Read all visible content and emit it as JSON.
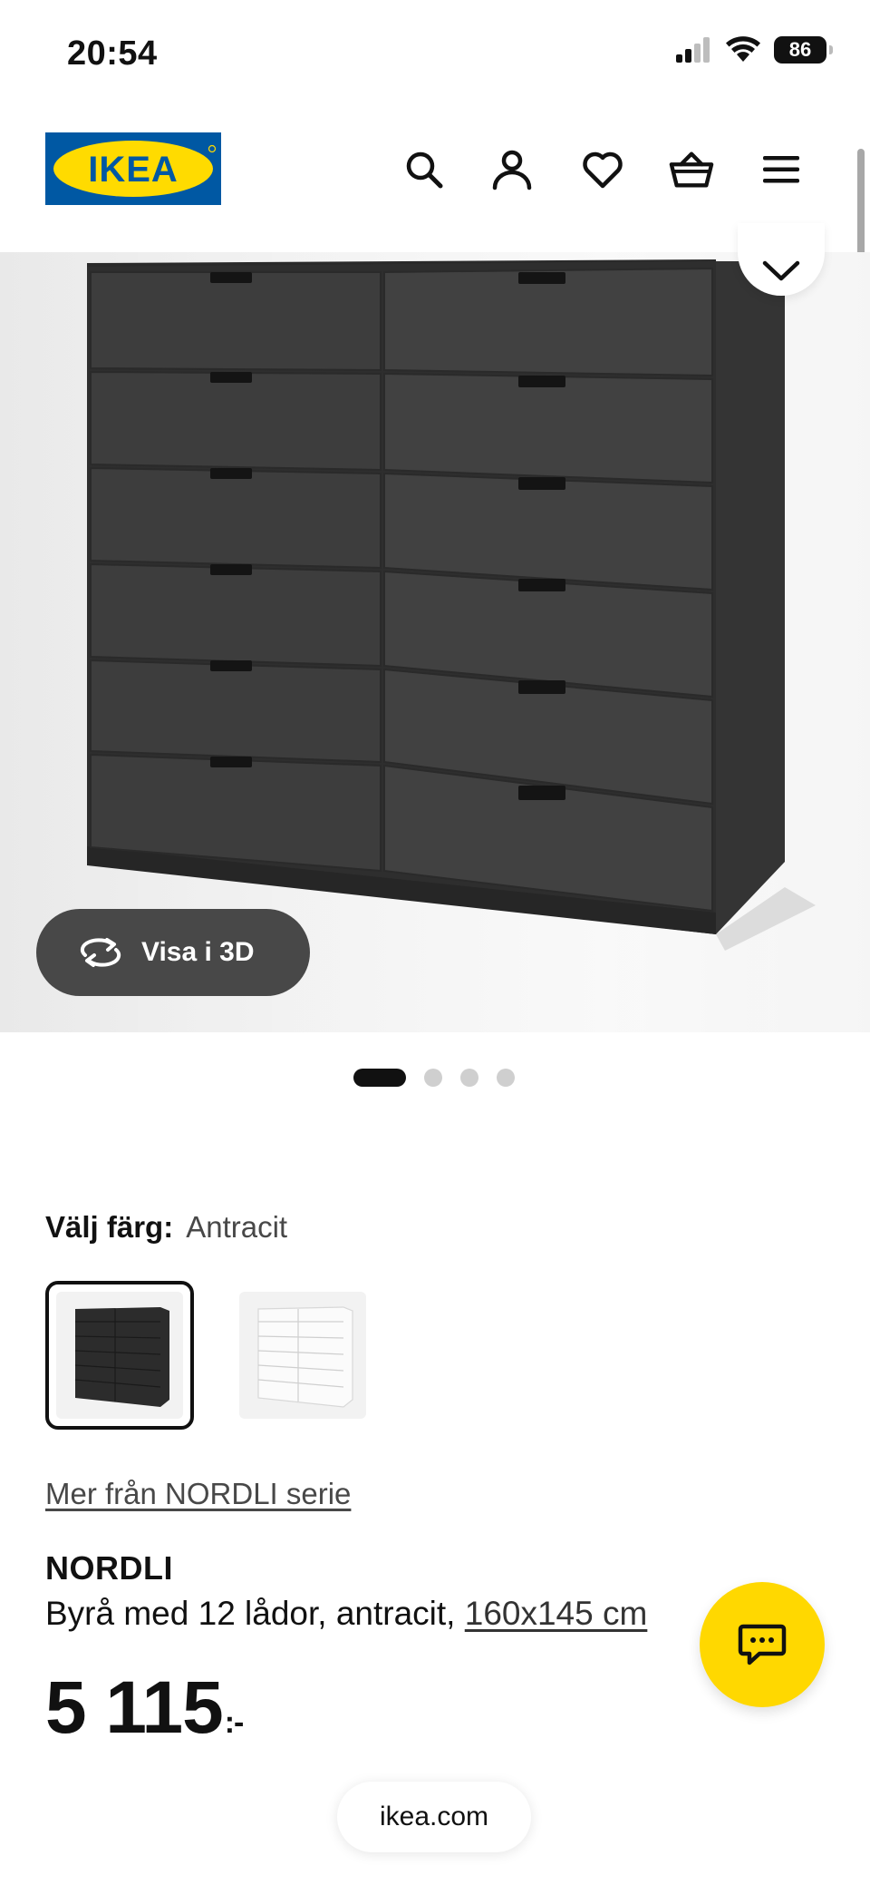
{
  "status_bar": {
    "time": "20:54",
    "battery": "86"
  },
  "header": {
    "logo_text": "IKEA",
    "icons": [
      "search-icon",
      "account-icon",
      "heart-icon",
      "basket-icon",
      "menu-icon"
    ]
  },
  "gallery": {
    "view_3d_label": "Visa i 3D",
    "active_index": 1,
    "image_count": 4
  },
  "color": {
    "label": "Välj färg:",
    "value": "Antracit",
    "options": [
      "Antracit",
      "Vit"
    ]
  },
  "series_link": "Mer från NORDLI serie",
  "product": {
    "name": "NORDLI",
    "description": "Byrå med 12 lådor, antracit,",
    "dimensions": "160x145 cm",
    "price": "5 115",
    "currency": ":-"
  },
  "browser": {
    "url": "ikea.com"
  },
  "colors": {
    "ikea_blue": "#0058a3",
    "ikea_yellow": "#ffdb00",
    "dresser": "#3b3b3b"
  }
}
